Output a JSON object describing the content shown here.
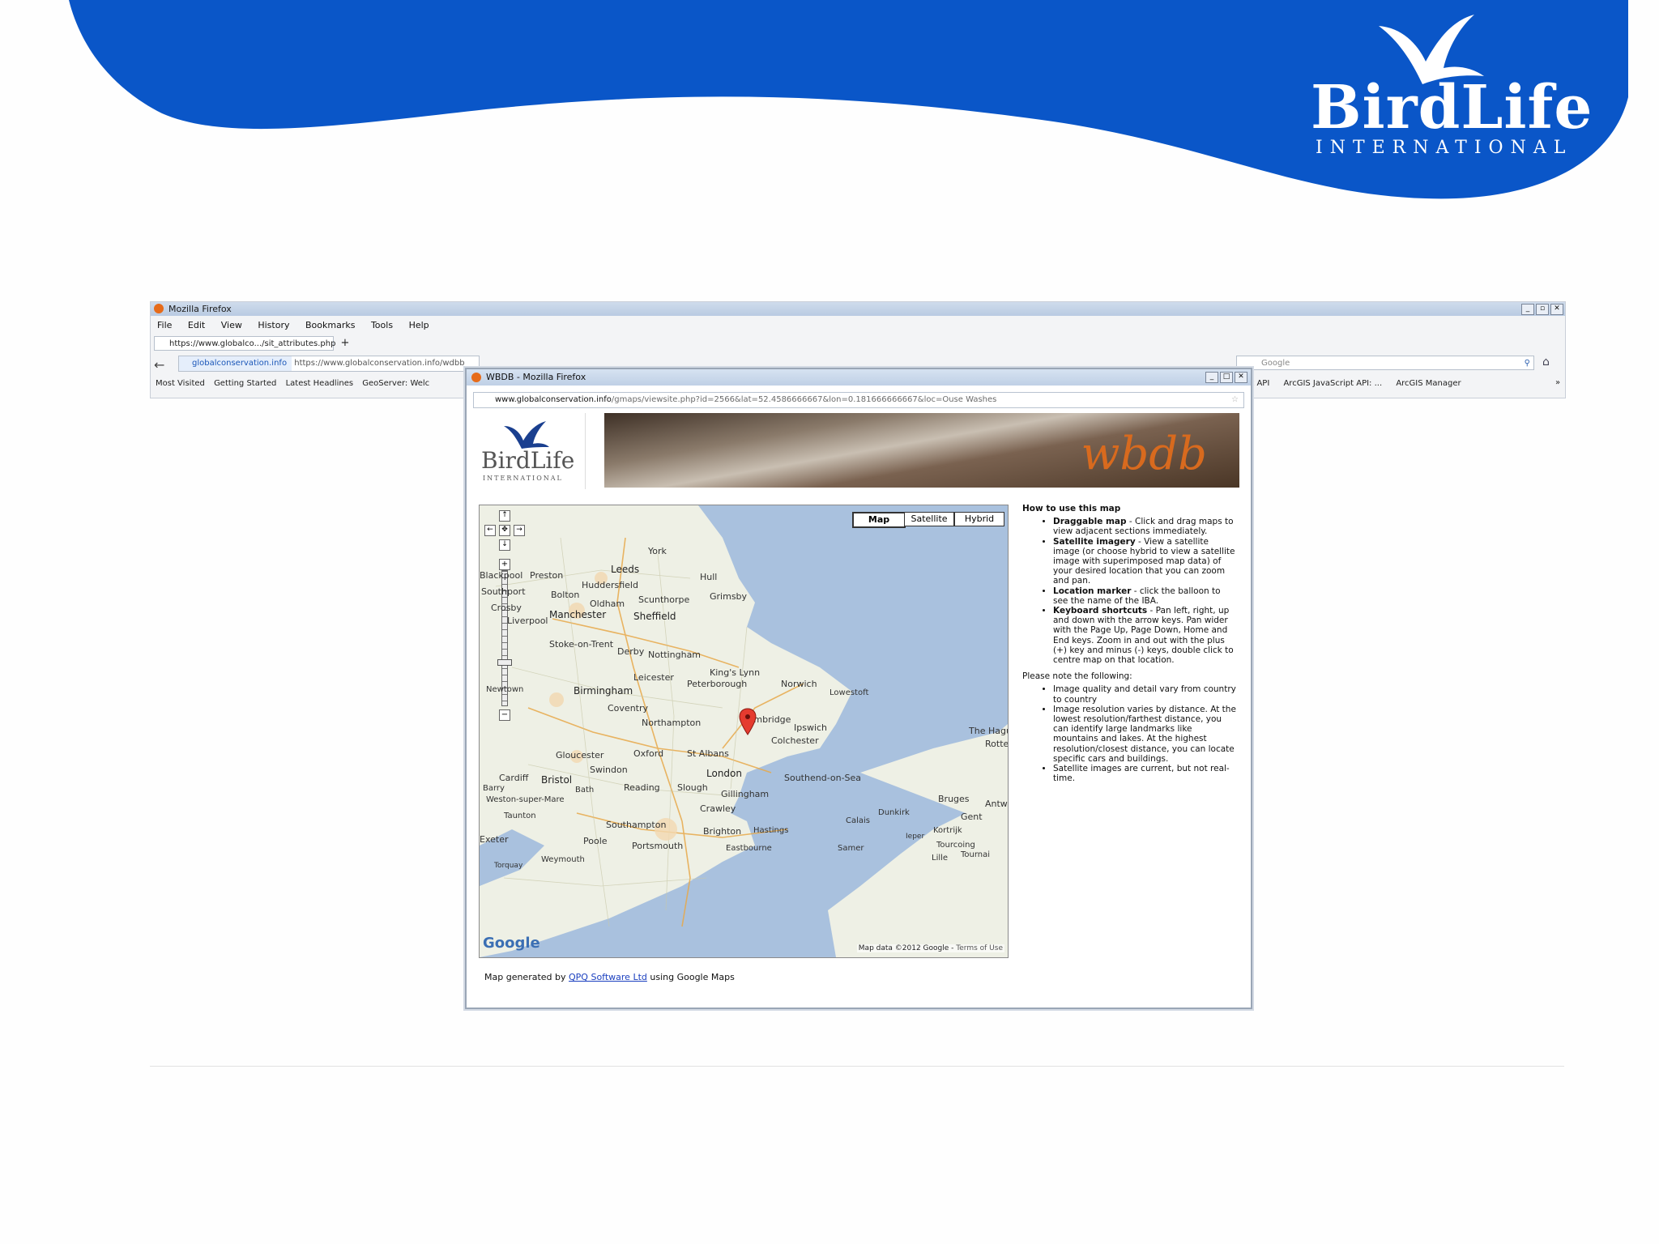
{
  "slide": {
    "brand_line1": "BirdLife",
    "brand_line2": "INTERNATIONAL",
    "colors": {
      "header_blue": "#0a56c8",
      "white": "#ffffff"
    }
  },
  "browser": {
    "title": "Mozilla Firefox",
    "menu": [
      "File",
      "Edit",
      "View",
      "History",
      "Bookmarks",
      "Tools",
      "Help"
    ],
    "tab_label": "https://www.globalco.../sit_attributes.php",
    "new_tab": "+",
    "identity": "globalconservation.info",
    "url": "https://www.globalconservation.info/wdbb",
    "search_placeholder": "Google",
    "bookmarks_left": [
      "Most Visited",
      "Getting Started",
      "Latest Headlines",
      "GeoServer: Welc"
    ],
    "bookmarks_right": [
      "pt API",
      "ArcGIS JavaScript API: ...",
      "ArcGIS Manager"
    ],
    "overflow": "»"
  },
  "popup": {
    "title": "WBDB - Mozilla Firefox",
    "url_host": "www.globalconservation.info",
    "url_path": "/gmaps/viewsite.php?id=2566&lat=52.4586666667&lon=0.181666666667&loc=Ouse Washes",
    "logo_line1": "BirdLife",
    "logo_line2": "INTERNATIONAL",
    "banner_text": "wbdb",
    "map_buttons": [
      "Map",
      "Satellite",
      "Hybrid"
    ],
    "map_attribution": "Map data ©2012 Google",
    "map_terms": "Terms of Use",
    "google_logo": "Google",
    "cities": [
      "York",
      "Leeds",
      "Hull",
      "Blackpool",
      "Preston",
      "Huddersfield",
      "Southport",
      "Bolton",
      "Grimsby",
      "Oldham",
      "Scunthorpe",
      "Crosby",
      "Manchester",
      "Sheffield",
      "Liverpool",
      "Stoke-on-Trent",
      "Derby",
      "Nottingham",
      "King's Lynn",
      "Leicester",
      "Peterborough",
      "Norwich",
      "Lowestoft",
      "Birmingham",
      "Coventry",
      "Northampton",
      "Cambridge",
      "Ipswich",
      "Newtown",
      "Colchester",
      "The Hague",
      "Rotterdam",
      "Gloucester",
      "Oxford",
      "St Albans",
      "Swindon",
      "London",
      "Southend-on-Sea",
      "Cardiff",
      "Bristol",
      "Reading",
      "Slough",
      "Gillingham",
      "Barry",
      "Bath",
      "Weston-super-Mare",
      "Crawley",
      "Bruges",
      "Antwerp",
      "Taunton",
      "Dunkirk",
      "Gent",
      "Calais",
      "Southampton",
      "Hastings",
      "Brighton",
      "Kortrijk",
      "Ieper",
      "Exeter",
      "Poole",
      "Portsmouth",
      "Eastbourne",
      "Tourcoing",
      "Samer",
      "Lille",
      "Tournai",
      "Weymouth",
      "Torquay"
    ],
    "help": {
      "heading": "How to use this map",
      "items": [
        {
          "term": "Draggable map",
          "text": " - Click and drag maps to view adjacent sections immediately."
        },
        {
          "term": "Satellite imagery",
          "text": " - View a satellite image (or choose hybrid to view a satellite image with superimposed map data) of your desired location that you can zoom and pan."
        },
        {
          "term": "Location marker",
          "text": " - click the balloon to see the name of the IBA."
        },
        {
          "term": "Keyboard shortcuts",
          "text": " - Pan left, right, up and down with the arrow keys. Pan wider with the Page Up, Page Down, Home and End keys. Zoom in and out with the plus (+) key and minus (-) keys, double click to centre map on that location."
        }
      ],
      "note_heading": "Please note the following:",
      "notes": [
        "Image quality and detail vary from country to country",
        "Image resolution varies by distance. At the lowest resolution/farthest distance, you can identify large landmarks like mountains and lakes. At the highest resolution/closest distance, you can locate specific cars and buildings.",
        "Satellite images are current, but not real-time."
      ]
    },
    "footer_prefix": "Map generated by ",
    "footer_link": "QPQ Software Ltd",
    "footer_suffix": " using Google Maps"
  }
}
